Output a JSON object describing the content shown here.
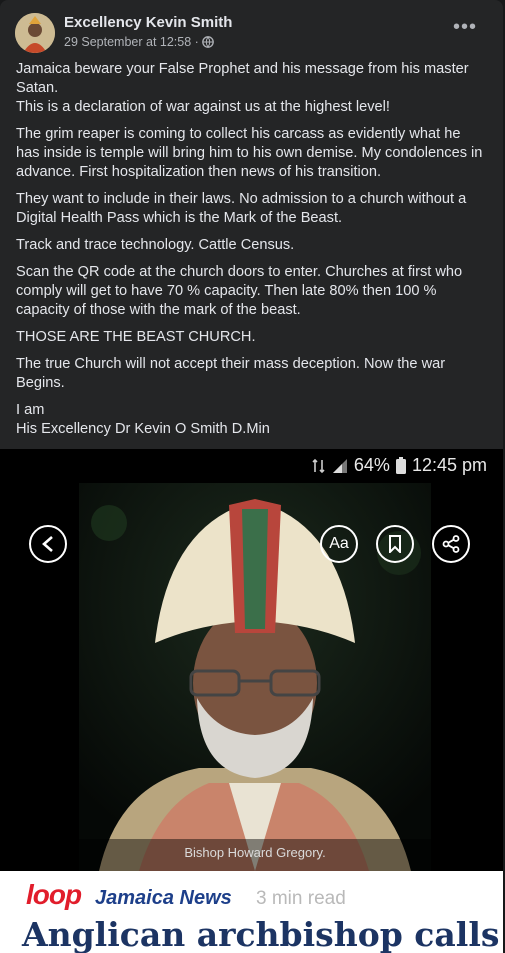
{
  "post": {
    "author": "Excellency Kevin Smith",
    "timestamp": "29 September at 12:58 ·",
    "more_icon": "more-horizontal-icon",
    "privacy_icon": "globe-icon",
    "paragraphs": [
      "Jamaica beware your False Prophet and his message from his master Satan.\nThis is a declaration of war against us at the highest level!",
      "The grim reaper is coming to collect his carcass as evidently what he has inside is temple will bring him to his own demise. My condolences in advance. First hospitalization then news of his transition.",
      "They want to include in their laws. No admission to a church without a Digital Health Pass which is the Mark of the Beast.",
      "Track and trace technology. Cattle Census.",
      "Scan the QR code at the church doors to enter. Churches at first who comply will get to have 70 % capacity. Then late 80% then 100 % capacity of those with the mark of the beast.",
      "THOSE ARE THE BEAST CHURCH.",
      "The true Church will not accept their mass deception. Now the war Begins.",
      "I am\nHis Excellency Dr Kevin O Smith D.Min"
    ]
  },
  "screenshot": {
    "status": {
      "battery": "64%",
      "time": "12:45 pm"
    },
    "caption": "Bishop Howard Gregory.",
    "news": {
      "brand": "loop",
      "section": "Jamaica News",
      "read_time": "3 min read",
      "headline": "Anglican archbishop calls"
    }
  },
  "colors": {
    "background": "#18191a",
    "card": "#242526",
    "text_primary": "#e4e6eb",
    "text_secondary": "#b0b3b8",
    "loop_red": "#e11d2b",
    "news_blue": "#1d3f8a"
  }
}
